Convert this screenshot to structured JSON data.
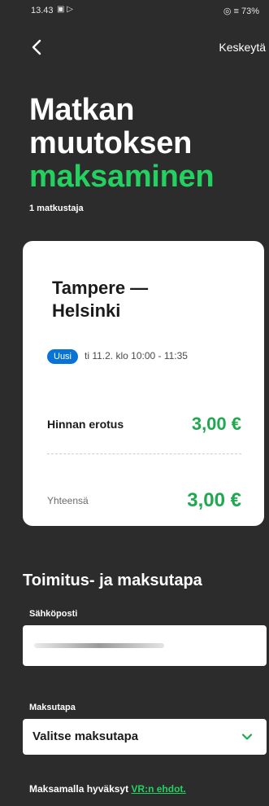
{
  "status_bar": {
    "time": "13.43",
    "left_icons": "▣ ▷",
    "right": "◎ ≡ 73%"
  },
  "nav": {
    "cancel_label": "Keskeytä"
  },
  "header": {
    "title_line1": "Matkan",
    "title_line2": "muutoksen",
    "title_line3": "maksaminen",
    "passengers": "1 matkustaja"
  },
  "trip_card": {
    "route_line1": "Tampere —",
    "route_line2": "Helsinki",
    "badge": "Uusi",
    "time": "ti 11.2. klo 10:00 - 11:35",
    "price_difference_label": "Hinnan erotus",
    "price_difference": "3,00 €",
    "total_label": "Yhteensä",
    "total": "3,00 €"
  },
  "delivery": {
    "section_title": "Toimitus- ja maksutapa",
    "email_label": "Sähköposti",
    "payment_label": "Maksutapa",
    "payment_value": "Valitse maksutapa"
  },
  "terms": {
    "prefix": "Maksamalla hyväksyt ",
    "link": "VR:n ehdot."
  },
  "colors": {
    "accent": "#24d160",
    "badge": "#0a74d6",
    "price": "#1fa84f",
    "background": "#2c2c2c"
  }
}
